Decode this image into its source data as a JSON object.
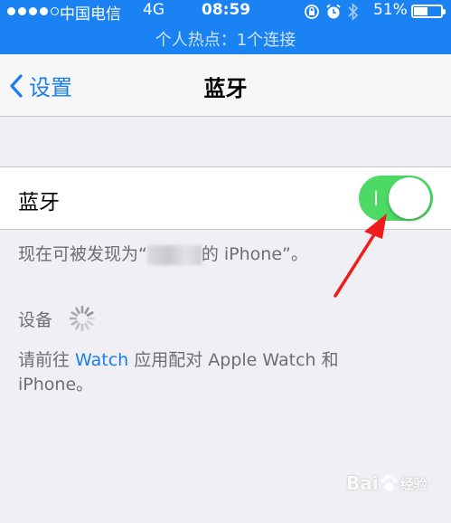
{
  "status_bar": {
    "carrier": "中国电信",
    "network": "4G",
    "time": "08:59",
    "battery": "51%",
    "battery_level": 0.51,
    "hotspot": "个人热点：1个连接",
    "signal_bars_filled": 4,
    "signal_bars_total": 5
  },
  "nav": {
    "back_label": "设置",
    "title": "蓝牙"
  },
  "bluetooth_cell": {
    "label": "蓝牙",
    "toggle_on": true
  },
  "discoverable": {
    "prefix": "现在可被发现为“",
    "suffix": "的 iPhone”。"
  },
  "devices": {
    "header": "设备"
  },
  "watch_note": {
    "before": "请前往 ",
    "link": "Watch",
    "after": " 应用配对 Apple Watch 和 iPhone。"
  },
  "watermark": {
    "logo": "Bai",
    "text": "经验"
  },
  "colors": {
    "status_bar": "#1b82f4",
    "accent": "#1a7cf5",
    "toggle_on": "#4cd964",
    "arrow": "#f11b1b"
  },
  "icons": [
    "chevron-left-icon",
    "rotation-lock-icon",
    "alarm-icon",
    "bluetooth-icon",
    "battery-icon",
    "loading-spinner-icon",
    "annotation-arrow"
  ]
}
